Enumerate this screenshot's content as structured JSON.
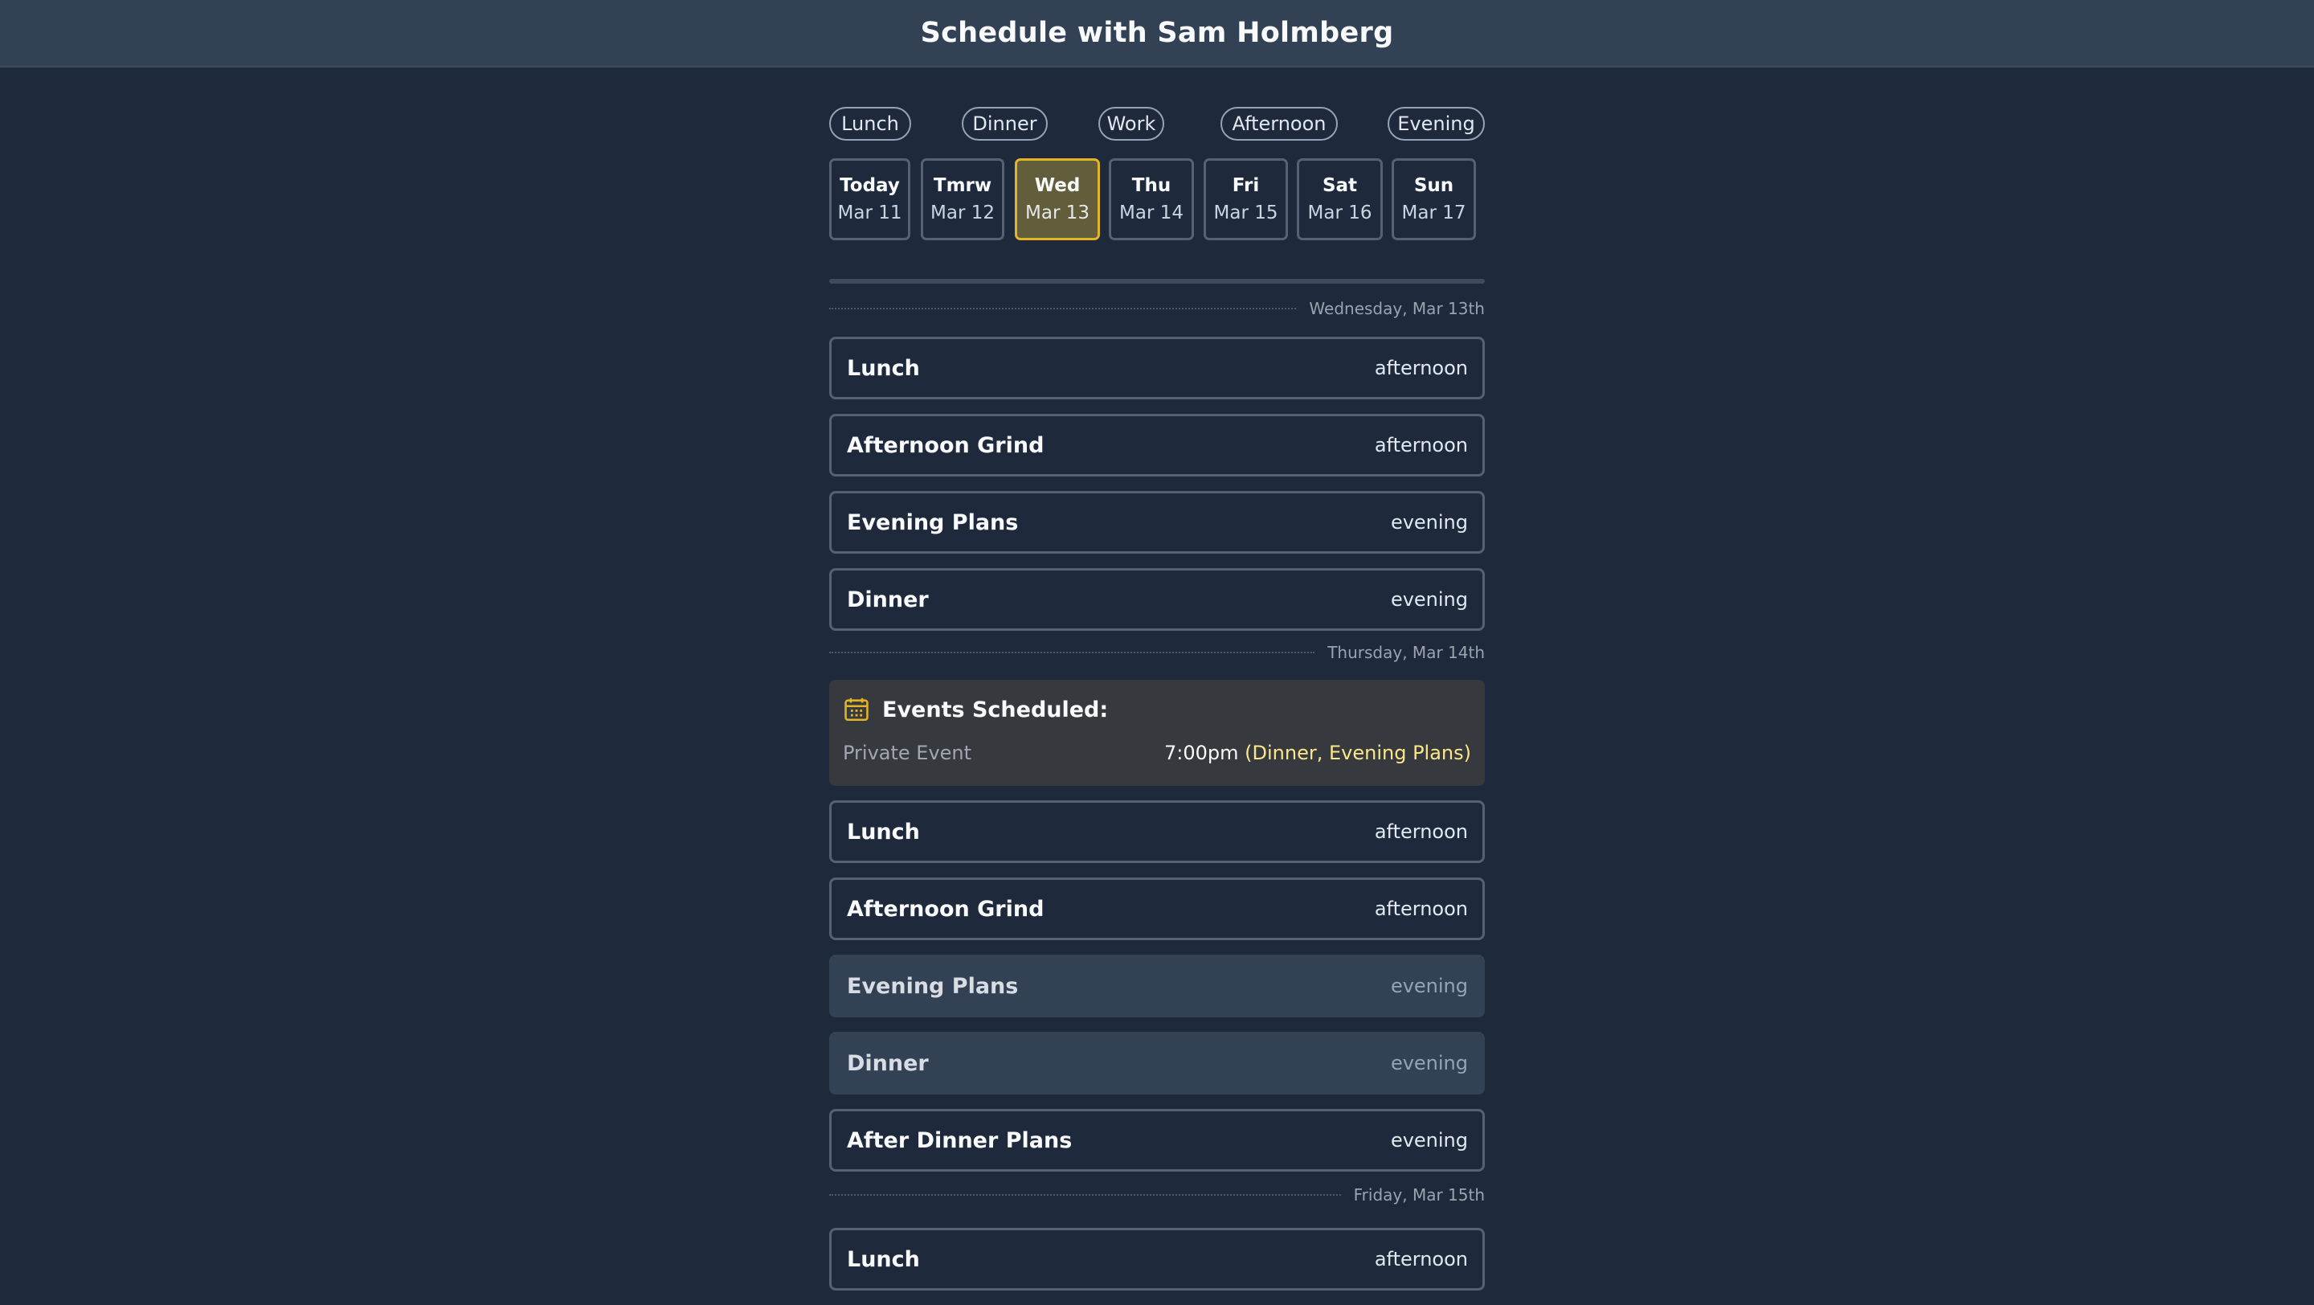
{
  "header": {
    "title": "Schedule with Sam Holmberg"
  },
  "filters": [
    "Lunch",
    "Dinner",
    "Work",
    "Afternoon",
    "Evening"
  ],
  "days": [
    {
      "name": "Today",
      "date": "Mar 11"
    },
    {
      "name": "Tmrw",
      "date": "Mar 12"
    },
    {
      "name": "Wed",
      "date": "Mar 13",
      "selected": true
    },
    {
      "name": "Thu",
      "date": "Mar 14"
    },
    {
      "name": "Fri",
      "date": "Mar 15"
    },
    {
      "name": "Sat",
      "date": "Mar 16"
    },
    {
      "name": "Sun",
      "date": "Mar 17"
    }
  ],
  "sections": [
    {
      "date_label": "Wednesday, Mar 13th",
      "slots": [
        {
          "name": "Lunch",
          "time": "afternoon"
        },
        {
          "name": "Afternoon Grind",
          "time": "afternoon"
        },
        {
          "name": "Evening Plans",
          "time": "evening"
        },
        {
          "name": "Dinner",
          "time": "evening"
        }
      ]
    },
    {
      "date_label": "Thursday, Mar 14th",
      "events": {
        "title": "Events Scheduled:",
        "icon": "calendar-icon",
        "items": [
          {
            "name": "Private Event",
            "time": "7:00pm",
            "slots": "(Dinner, Evening Plans)"
          }
        ]
      },
      "slots": [
        {
          "name": "Lunch",
          "time": "afternoon"
        },
        {
          "name": "Afternoon Grind",
          "time": "afternoon"
        },
        {
          "name": "Evening Plans",
          "time": "evening",
          "booked": true
        },
        {
          "name": "Dinner",
          "time": "evening",
          "booked": true
        },
        {
          "name": "After Dinner Plans",
          "time": "evening"
        }
      ]
    },
    {
      "date_label": "Friday, Mar 15th",
      "slots": [
        {
          "name": "Lunch",
          "time": "afternoon"
        }
      ]
    }
  ],
  "colors": {
    "background": "#1e293b",
    "header": "#334155",
    "accent": "#e3b524",
    "selected_day_bg": "#625d3a",
    "event_slot_text": "#fde68a"
  }
}
